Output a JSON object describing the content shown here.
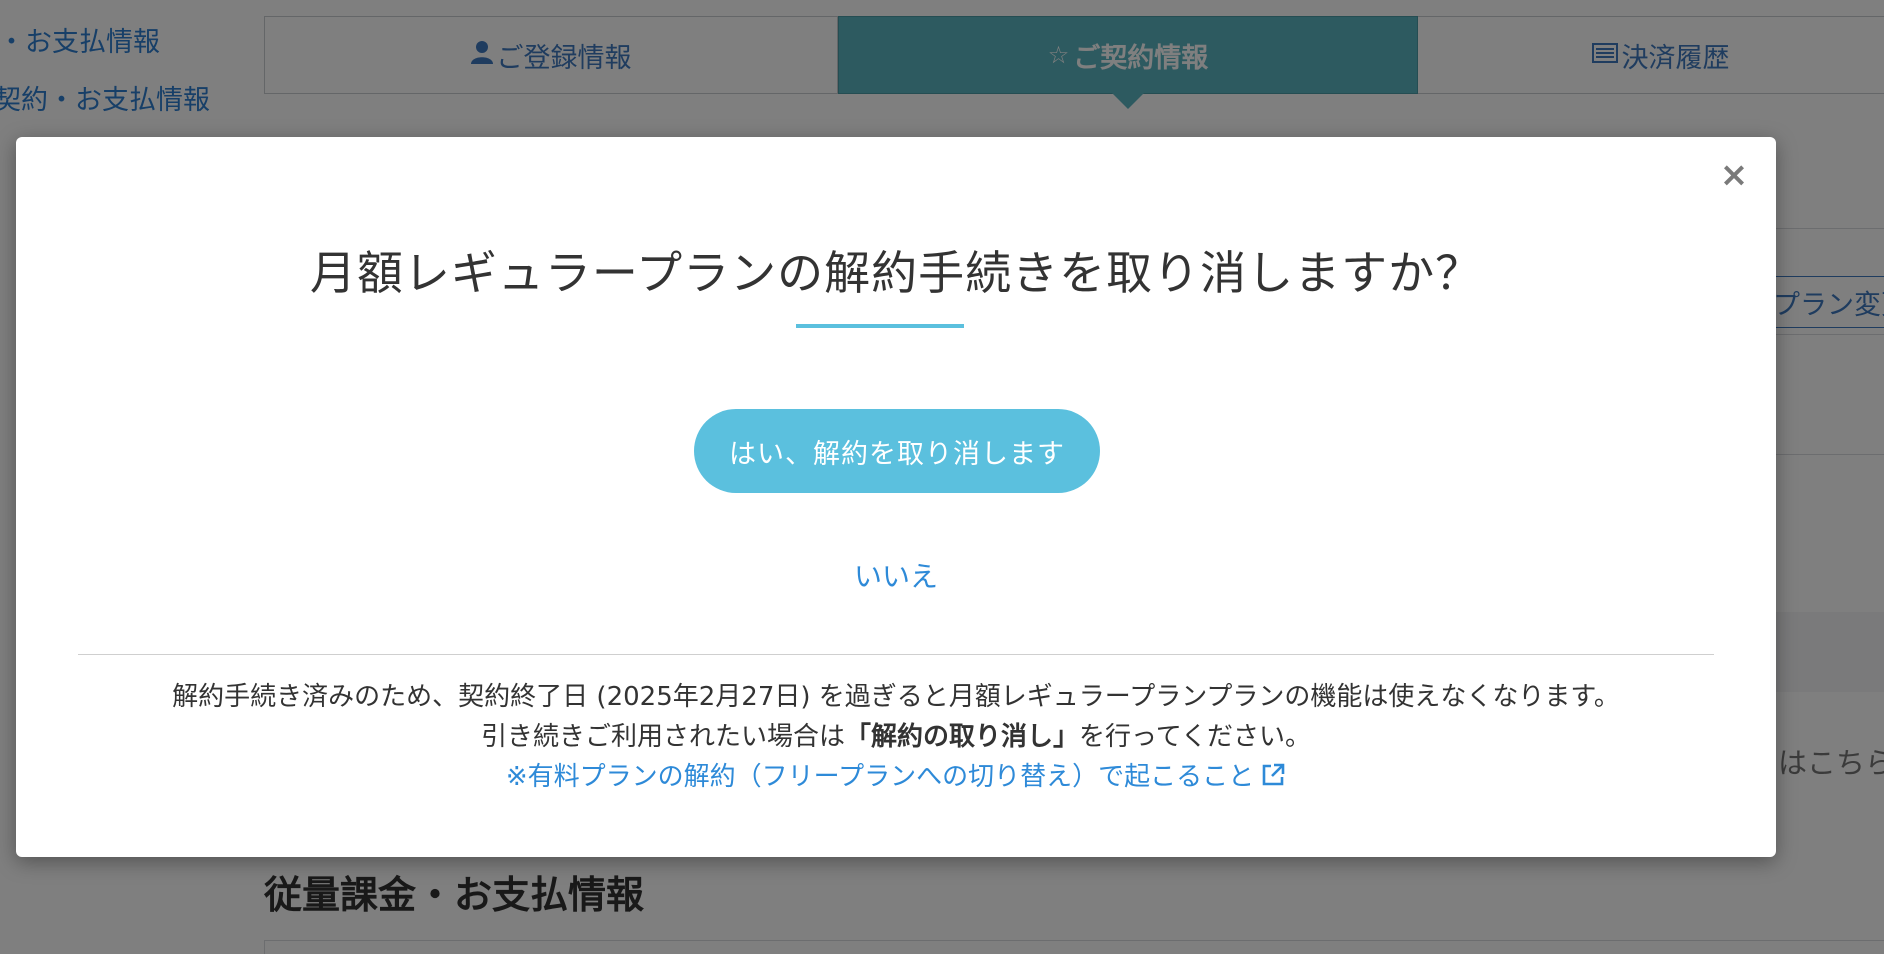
{
  "sidebar": {
    "links": [
      "・お支払情報",
      "契約・お支払情報"
    ]
  },
  "tabs": [
    {
      "icon": "user-icon",
      "label": "ご登録情報",
      "active": false
    },
    {
      "icon": "star-icon",
      "label": "ご契約情報",
      "active": true
    },
    {
      "icon": "list-icon",
      "label": "決済履歴",
      "active": false
    }
  ],
  "background": {
    "plan_change_button": "プラン変更",
    "right_text": "はこちら",
    "section_title": "従量課金・お支払情報"
  },
  "modal": {
    "close_label": "×",
    "title": "月額レギュラープランの解約手続きを取り消しますか？",
    "confirm_button": "はい、解約を取り消します",
    "no_link": "いいえ",
    "notice_line1": "解約手続き済みのため、契約終了日 (2025年2月27日) を過ぎると月額レギュラープランプランの機能は使えなくなります。",
    "notice_line2_prefix": "引き続きご利用されたい場合は",
    "notice_line2_bold": "「解約の取り消し」",
    "notice_line2_suffix": "を行ってください。",
    "notice_link": "※有料プランの解約（フリープランへの切り替え）で起こること",
    "accent_color": "#5bc0de",
    "link_color": "#2e8ad8"
  }
}
